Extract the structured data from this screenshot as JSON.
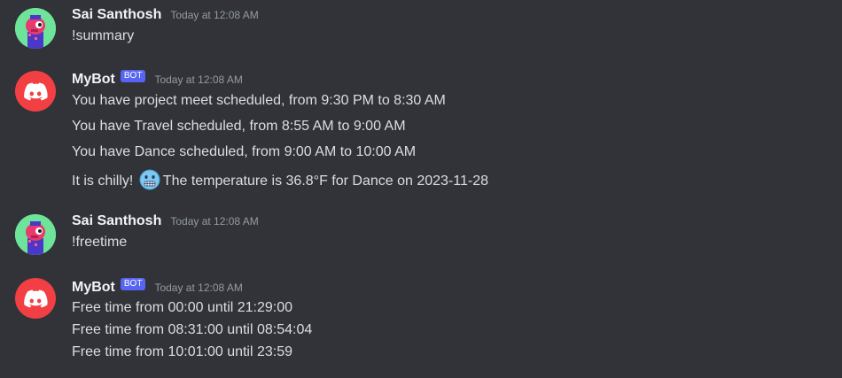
{
  "messages": [
    {
      "author": "Sai Santhosh",
      "timestamp": "Today at 12:08 AM",
      "lines": [
        "!summary"
      ]
    },
    {
      "author": "MyBot",
      "badge": "BOT",
      "timestamp": "Today at 12:08 AM",
      "lines": [
        "You have project meet scheduled, from 9:30 PM to 8:30 AM",
        "You have Travel scheduled, from 8:55 AM to 9:00 AM",
        "You have Dance scheduled, from 9:00 AM to 10:00 AM"
      ],
      "weather": {
        "before": "It is chilly!",
        "emoji": "cold-face-emoji",
        "after": "The temperature is 36.8°F for Dance on 2023-11-28"
      }
    },
    {
      "author": "Sai Santhosh",
      "timestamp": "Today at 12:08 AM",
      "lines": [
        "!freetime"
      ]
    },
    {
      "author": "MyBot",
      "badge": "BOT",
      "timestamp": "Today at 12:08 AM",
      "lines": [
        "Free time from 00:00 until 21:29:00",
        "Free time from 08:31:00 until 08:54:04",
        "Free time from 10:01:00 until 23:59"
      ]
    }
  ],
  "colors": {
    "background": "#313338",
    "text": "#dbdee1",
    "username": "#f2f3f5",
    "timestamp": "#949ba4",
    "bot_badge": "#5865f2",
    "bot_avatar": "#f23f43",
    "user_avatar": "#6ee39a"
  }
}
